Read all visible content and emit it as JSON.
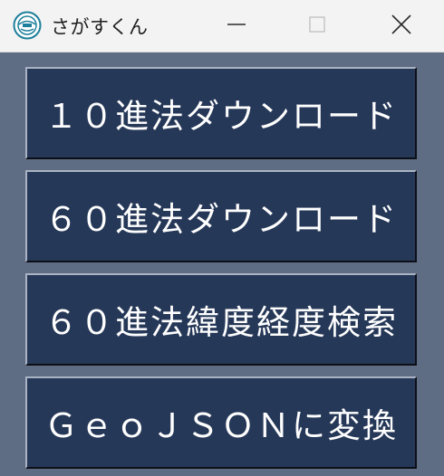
{
  "window": {
    "title": "さがすくん",
    "app_icon": "app-logo-icon",
    "controls": {
      "minimize_icon": "minimize-icon",
      "maximize_icon": "maximize-icon",
      "close_icon": "close-icon"
    }
  },
  "buttons": [
    {
      "label": "１０進法ダウンロード"
    },
    {
      "label": "６０進法ダウンロード"
    },
    {
      "label": "６０進法緯度経度検索"
    },
    {
      "label": "ＧｅｏＪＳＯＮに変換"
    }
  ],
  "colors": {
    "window_background": "#5f6d84",
    "button_background": "#263858",
    "button_text": "#ffffff",
    "titlebar_background": "#f3f3f3"
  }
}
